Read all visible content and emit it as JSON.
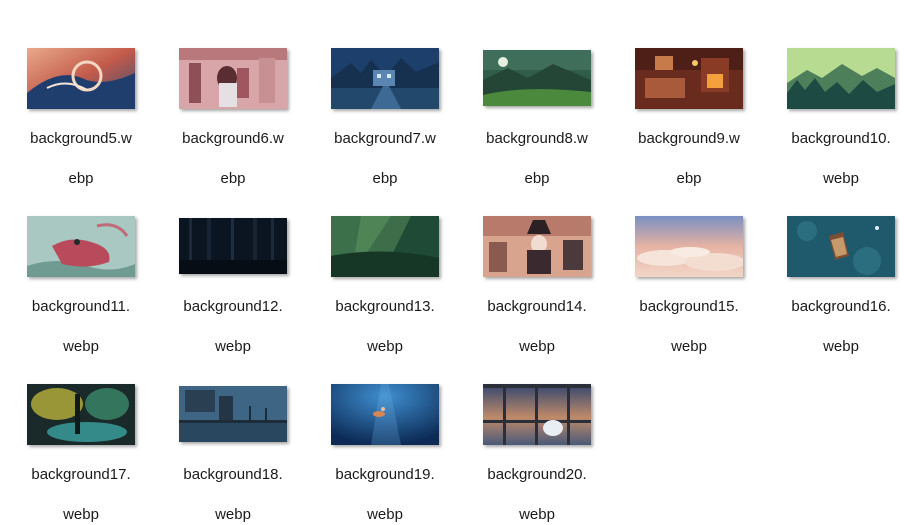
{
  "files": [
    {
      "name": "background5.webp",
      "label_line1": "background5.w",
      "label_line2": "ebp",
      "icon": "image-thumbnail-wave"
    },
    {
      "name": "background6.webp",
      "label_line1": "background6.w",
      "label_line2": "ebp",
      "icon": "image-thumbnail-anime-girl"
    },
    {
      "name": "background7.webp",
      "label_line1": "background7.w",
      "label_line2": "ebp",
      "icon": "image-thumbnail-night-street"
    },
    {
      "name": "background8.webp",
      "label_line1": "background8.w",
      "label_line2": "ebp",
      "icon": "image-thumbnail-green-valley"
    },
    {
      "name": "background9.webp",
      "label_line1": "background9.w",
      "label_line2": "ebp",
      "icon": "image-thumbnail-cozy-room"
    },
    {
      "name": "background10.webp",
      "label_line1": "background10.",
      "label_line2": "webp",
      "icon": "image-thumbnail-mountain-forest"
    },
    {
      "name": "background11.webp",
      "label_line1": "background11.",
      "label_line2": "webp",
      "icon": "image-thumbnail-creature"
    },
    {
      "name": "background12.webp",
      "label_line1": "background12.",
      "label_line2": "webp",
      "icon": "image-thumbnail-dark-forest"
    },
    {
      "name": "background13.webp",
      "label_line1": "background13.",
      "label_line2": "webp",
      "icon": "image-thumbnail-sunlit-forest"
    },
    {
      "name": "background14.webp",
      "label_line1": "background14.",
      "label_line2": "webp",
      "icon": "image-thumbnail-witch"
    },
    {
      "name": "background15.webp",
      "label_line1": "background15.",
      "label_line2": "webp",
      "icon": "image-thumbnail-clouds"
    },
    {
      "name": "background16.webp",
      "label_line1": "background16.",
      "label_line2": "webp",
      "icon": "image-thumbnail-boat"
    },
    {
      "name": "background17.webp",
      "label_line1": "background17.",
      "label_line2": "webp",
      "icon": "image-thumbnail-glowing-forest"
    },
    {
      "name": "background18.webp",
      "label_line1": "background18.",
      "label_line2": "webp",
      "icon": "image-thumbnail-pier"
    },
    {
      "name": "background19.webp",
      "label_line1": "background19.",
      "label_line2": "webp",
      "icon": "image-thumbnail-underwater"
    },
    {
      "name": "background20.webp",
      "label_line1": "background20.",
      "label_line2": "webp",
      "icon": "image-thumbnail-window-city"
    }
  ]
}
